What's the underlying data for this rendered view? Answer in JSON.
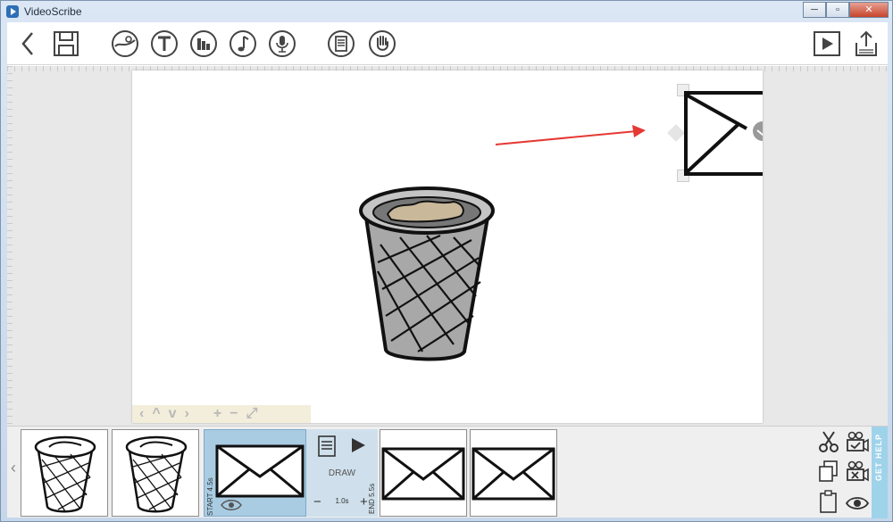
{
  "window": {
    "title": "VideoScribe",
    "min": "─",
    "max": "▫",
    "close": "✕"
  },
  "toolbar": {
    "left": [
      "back-icon",
      "save-icon"
    ],
    "center": [
      "image-icon",
      "text-icon",
      "chart-icon",
      "music-icon",
      "voiceover-icon",
      "properties-icon",
      "hand-icon"
    ],
    "right": [
      "play-preview-icon",
      "export-icon"
    ]
  },
  "stage": {
    "zoom_controls": [
      "‹",
      "^",
      "v",
      "›",
      "+",
      "−",
      "⤢"
    ]
  },
  "timeline": {
    "thumbnails": [
      {
        "content": "trash-bin"
      },
      {
        "content": "trash-bin"
      },
      {
        "content": "envelope",
        "selected": true
      },
      {
        "content": "envelope"
      },
      {
        "content": "envelope"
      }
    ],
    "selected_start": "START  4.5s",
    "selected_end": "END  5.5s",
    "action_label": "DRAW",
    "duration_value": "1.0s",
    "minus": "−",
    "plus": "+"
  },
  "right_tools": [
    "scissors-icon",
    "camera-check-icon",
    "copy-icon",
    "camera-x-icon",
    "clipboard-icon",
    "eye-icon"
  ],
  "help_tab": "GET HELP",
  "colors": {
    "accent": "#a9cce3",
    "arrow": "#e53935",
    "help": "#9fd3ea"
  }
}
